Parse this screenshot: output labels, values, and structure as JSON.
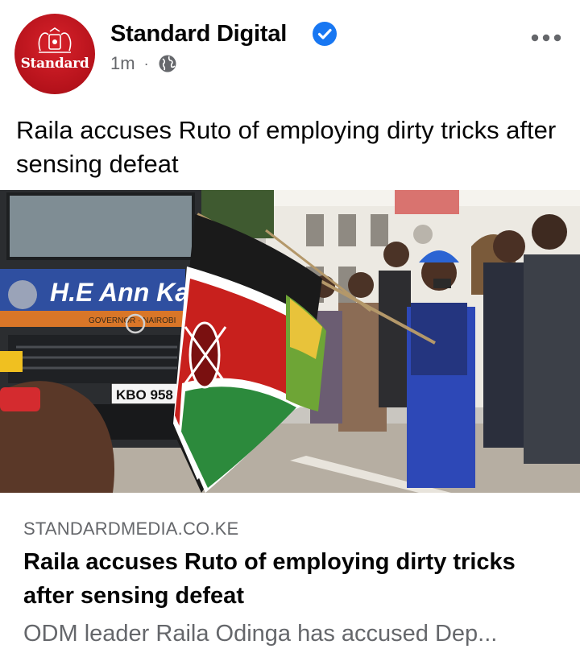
{
  "post": {
    "page_name": "Standard Digital",
    "avatar_text": "Standard",
    "timestamp": "1m",
    "separator": "·",
    "privacy_icon": "globe-icon",
    "verified_icon": "verified-badge-icon",
    "more_icon": "more-options-icon",
    "text": "Raila accuses Ruto of employing dirty tricks after sensing defeat"
  },
  "photo": {
    "banner_text": "H.E Ann Ka",
    "banner_subtext": "GOVERNOR · NAIROBI",
    "plate_text": "KBO 958"
  },
  "link_preview": {
    "domain": "STANDARDMEDIA.CO.KE",
    "title": "Raila accuses Ruto of employing dirty tricks after sensing defeat",
    "description": "ODM leader Raila Odinga has accused Dep..."
  },
  "colors": {
    "brand_red": "#c4161c",
    "verified_blue": "#1877f2",
    "secondary_text": "#65676b"
  }
}
